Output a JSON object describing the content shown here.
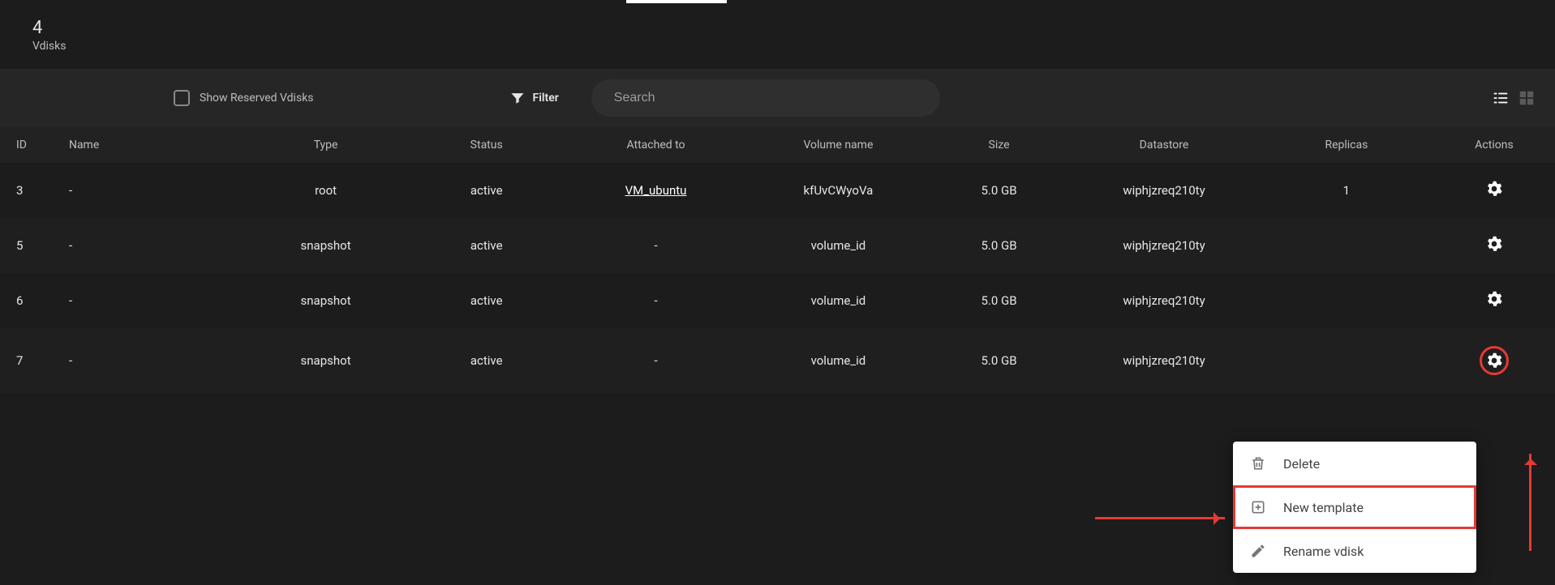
{
  "summary": {
    "count": "4",
    "label": "Vdisks"
  },
  "toolbar": {
    "checkbox_label": "Show Reserved Vdisks",
    "filter_label": "Filter",
    "search_placeholder": "Search"
  },
  "columns": {
    "id": "ID",
    "name": "Name",
    "type": "Type",
    "status": "Status",
    "attached": "Attached to",
    "volume": "Volume name",
    "size": "Size",
    "datastore": "Datastore",
    "replicas": "Replicas",
    "actions": "Actions"
  },
  "rows": [
    {
      "id": "3",
      "name": "-",
      "type": "root",
      "status": "active",
      "attached": "VM_ubuntu",
      "attached_link": true,
      "volume": "kfUvCWyoVa",
      "size": "5.0 GB",
      "datastore": "wiphjzreq210ty",
      "replicas": "1",
      "circled": false
    },
    {
      "id": "5",
      "name": "-",
      "type": "snapshot",
      "status": "active",
      "attached": "-",
      "attached_link": false,
      "volume": "volume_id",
      "size": "5.0 GB",
      "datastore": "wiphjzreq210ty",
      "replicas": "",
      "circled": false
    },
    {
      "id": "6",
      "name": "-",
      "type": "snapshot",
      "status": "active",
      "attached": "-",
      "attached_link": false,
      "volume": "volume_id",
      "size": "5.0 GB",
      "datastore": "wiphjzreq210ty",
      "replicas": "",
      "circled": false
    },
    {
      "id": "7",
      "name": "-",
      "type": "snapshot",
      "status": "active",
      "attached": "-",
      "attached_link": false,
      "volume": "volume_id",
      "size": "5.0 GB",
      "datastore": "wiphjzreq210ty",
      "replicas": "",
      "circled": true
    }
  ],
  "menu": {
    "items": [
      {
        "icon": "trash",
        "label": "Delete",
        "highlight": false
      },
      {
        "icon": "new",
        "label": "New template",
        "highlight": true
      },
      {
        "icon": "pencil",
        "label": "Rename vdisk",
        "highlight": false
      }
    ]
  },
  "annotation": {
    "red": "#e53935"
  }
}
